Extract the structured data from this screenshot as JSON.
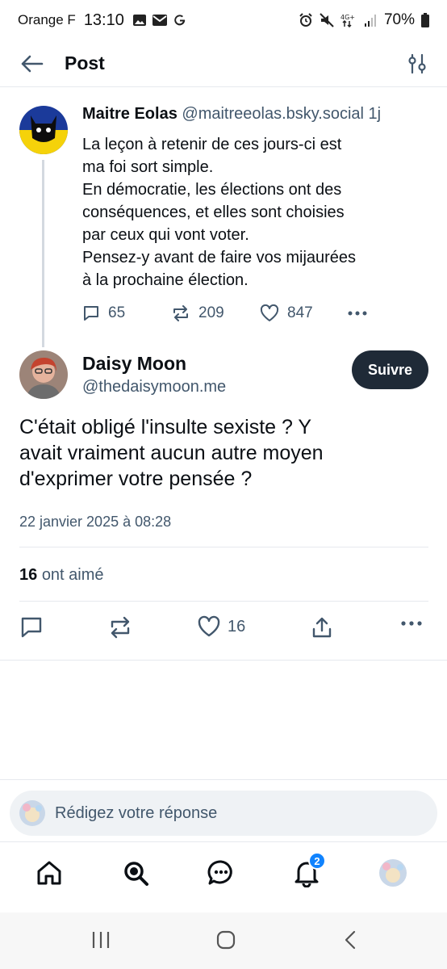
{
  "status_bar": {
    "carrier": "Orange F",
    "time": "13:10",
    "battery": "70%"
  },
  "header": {
    "title": "Post"
  },
  "parent_post": {
    "author_name": "Maitre Eolas",
    "author_handle": "@maitreeolas.bsky.social",
    "time_ago": "1j",
    "text": "La leçon à retenir de ces jours-ci est\nma foi sort simple.\nEn démocratie, les élections ont des\nconséquences, et elles sont choisies\npar ceux qui vont voter.\nPensez-y avant de faire vos mijaurées\nà la prochaine élection.",
    "replies": "65",
    "reposts": "209",
    "likes": "847"
  },
  "main_post": {
    "author_name": "Daisy Moon",
    "author_handle": "@thedaisymoon.me",
    "follow_label": "Suivre",
    "text": "C'était obligé l'insulte sexiste ? Y\navait vraiment aucun autre moyen\nd'exprimer votre pensée ?",
    "date": "22 janvier 2025 à 08:28",
    "likes_count": "16",
    "likes_label": "ont aimé",
    "like_action_count": "16"
  },
  "reply_box": {
    "placeholder": "Rédigez votre réponse"
  },
  "tab_bar": {
    "notifications_badge": "2"
  },
  "colors": {
    "accent": "#1083fe",
    "text_secondary": "#42576c",
    "button_dark": "#1f2a37"
  }
}
